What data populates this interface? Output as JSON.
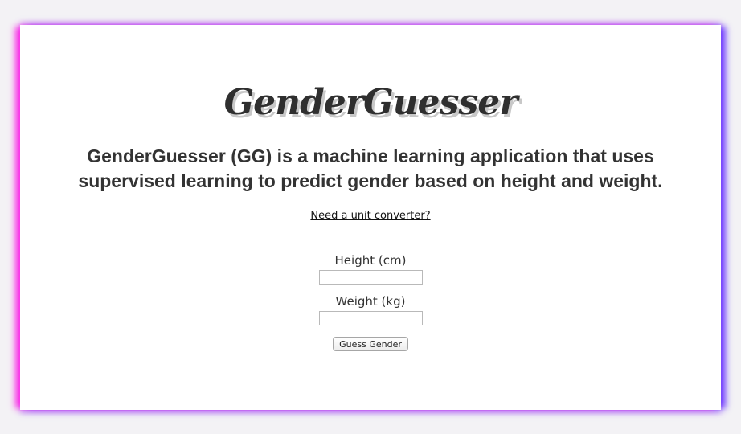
{
  "header": {
    "logo_text": "GenderGuesser"
  },
  "main": {
    "description": "GenderGuesser (GG) is a machine learning application that uses supervised learning to predict gender based on height and weight.",
    "converter_link": "Need a unit converter?"
  },
  "form": {
    "height": {
      "label": "Height (cm)",
      "value": ""
    },
    "weight": {
      "label": "Weight (kg)",
      "value": ""
    },
    "submit_label": "Guess Gender"
  },
  "colors": {
    "page_background": "#f3f2f5",
    "card_background": "#ffffff",
    "glow_left": "#ff28e6",
    "glow_right": "#6e3cff",
    "text": "#333333"
  }
}
